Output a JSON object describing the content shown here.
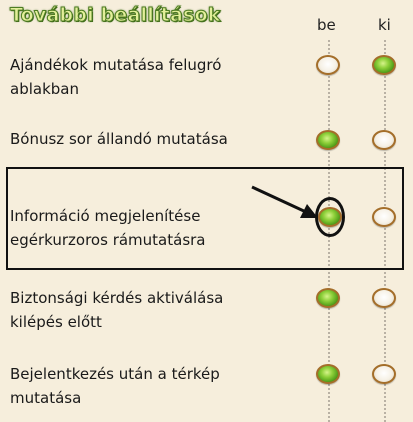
{
  "header": {
    "title": "További beállítások",
    "col_on": "be",
    "col_off": "ki"
  },
  "settings": [
    {
      "label_line1": "Ajándékok mutatása felugró",
      "label_line2": "ablakban",
      "selected": "ki"
    },
    {
      "label_line1": "Bónusz sor állandó mutatása",
      "label_line2": "",
      "selected": "be"
    },
    {
      "label_line1": "Információ megjelenítése",
      "label_line2": "egérkurzoros rámutatásra",
      "selected": "be"
    },
    {
      "label_line1": "Biztonsági kérdés aktiválása",
      "label_line2": "kilépés előtt",
      "selected": "be"
    },
    {
      "label_line1": "Bejelentkezés után a térkép",
      "label_line2": "mutatása",
      "selected": "be"
    }
  ],
  "colors": {
    "title_fill": "#e3ef9a",
    "title_outline": "#4e7d22",
    "radio_on": "#6fbf2a",
    "radio_border": "#a46e2a",
    "background": "#f6eedc"
  }
}
